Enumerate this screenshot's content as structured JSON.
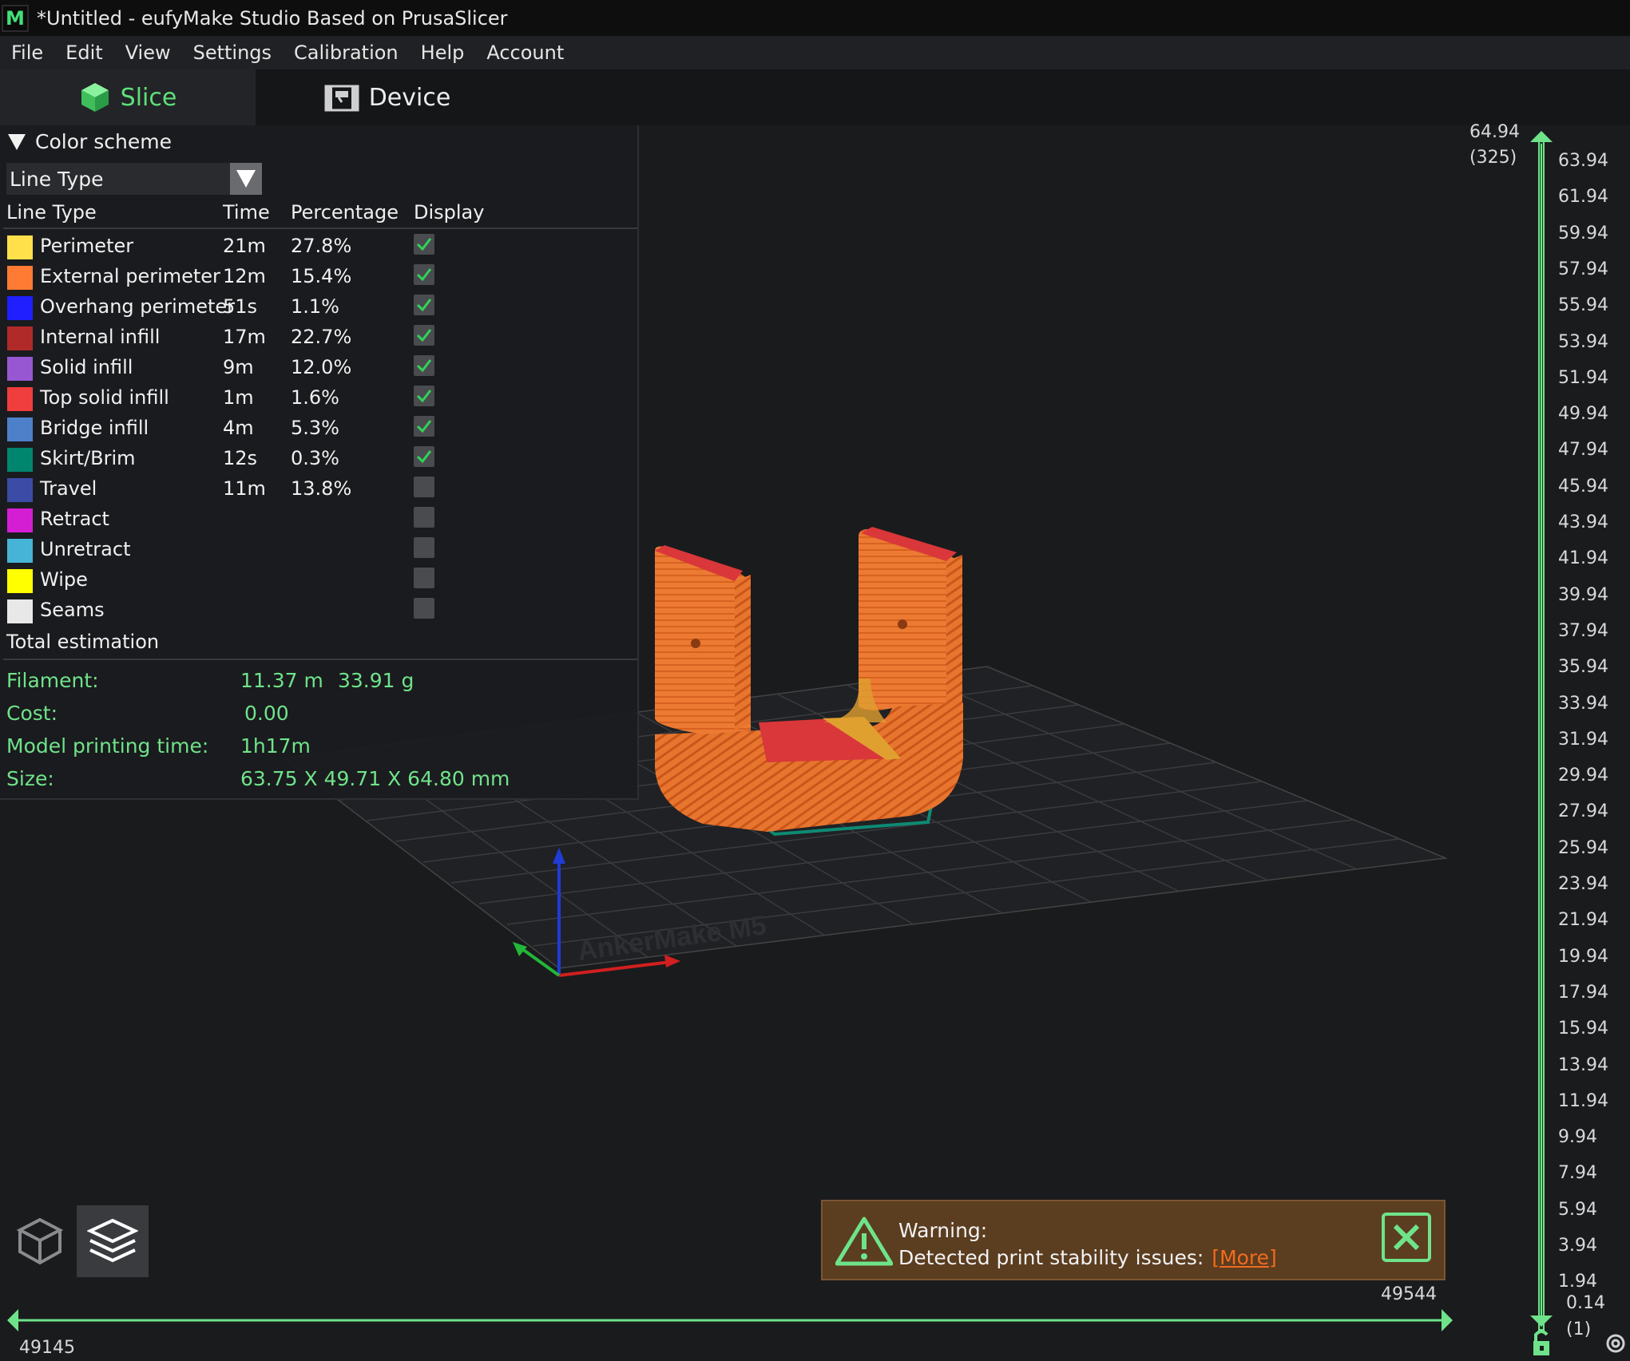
{
  "window": {
    "title": "*Untitled - eufyMake Studio Based on PrusaSlicer",
    "app_icon_letter": "M"
  },
  "menu": [
    "File",
    "Edit",
    "View",
    "Settings",
    "Calibration",
    "Help",
    "Account"
  ],
  "tabs": {
    "slice": "Slice",
    "device": "Device"
  },
  "legend": {
    "header": "Color scheme",
    "scheme_selected": "Line Type",
    "columns": {
      "type": "Line Type",
      "time": "Time",
      "percentage": "Percentage",
      "display": "Display"
    },
    "rows": [
      {
        "label": "Perimeter",
        "time": "21m",
        "pct": "27.8%",
        "color": "#FFE04A",
        "display": true
      },
      {
        "label": "External perimeter",
        "time": "12m",
        "pct": "15.4%",
        "color": "#FF7B33",
        "display": true
      },
      {
        "label": "Overhang perimeter",
        "time": "51s",
        "pct": "1.1%",
        "color": "#1F1FFF",
        "display": true
      },
      {
        "label": "Internal infill",
        "time": "17m",
        "pct": "22.7%",
        "color": "#B02A2A",
        "display": true
      },
      {
        "label": "Solid infill",
        "time": "9m",
        "pct": "12.0%",
        "color": "#9757D3",
        "display": true
      },
      {
        "label": "Top solid infill",
        "time": "1m",
        "pct": "1.6%",
        "color": "#F03D3D",
        "display": true
      },
      {
        "label": "Bridge infill",
        "time": "4m",
        "pct": "5.3%",
        "color": "#4D80C8",
        "display": true
      },
      {
        "label": "Skirt/Brim",
        "time": "12s",
        "pct": "0.3%",
        "color": "#00856E",
        "display": true
      },
      {
        "label": "Travel",
        "time": "11m",
        "pct": "13.8%",
        "color": "#3B4BA6",
        "display": false
      },
      {
        "label": "Retract",
        "time": "",
        "pct": "",
        "color": "#D41ED4",
        "display": false
      },
      {
        "label": "Unretract",
        "time": "",
        "pct": "",
        "color": "#45B4D6",
        "display": false
      },
      {
        "label": "Wipe",
        "time": "",
        "pct": "",
        "color": "#FFFF00",
        "display": false
      },
      {
        "label": "Seams",
        "time": "",
        "pct": "",
        "color": "#E8E8E8",
        "display": false
      }
    ],
    "total": {
      "label": "Total estimation",
      "filament_label": "Filament:",
      "filament_length": "11.37 m",
      "filament_weight": "33.91 g",
      "cost_label": "Cost:",
      "cost": "0.00",
      "time_label": "Model printing time:",
      "time": "1h17m",
      "size_label": "Size:",
      "size": "63.75 X 49.71 X 64.80 mm"
    }
  },
  "vertical_slider": {
    "top_value": "64.94",
    "top_layer": "(325)",
    "bottom_value": "0.14",
    "bottom_layer": "(1)",
    "ticks": [
      "63.94",
      "61.94",
      "59.94",
      "57.94",
      "55.94",
      "53.94",
      "51.94",
      "49.94",
      "47.94",
      "45.94",
      "43.94",
      "41.94",
      "39.94",
      "37.94",
      "35.94",
      "33.94",
      "31.94",
      "29.94",
      "27.94",
      "25.94",
      "23.94",
      "21.94",
      "19.94",
      "17.94",
      "15.94",
      "13.94",
      "11.94",
      "9.94",
      "7.94",
      "5.94",
      "3.94",
      "1.94"
    ]
  },
  "horizontal_slider": {
    "left_value": "49145",
    "right_value": "49544"
  },
  "bed_label": "AnkerMake M5",
  "warning": {
    "title": "Warning:",
    "message": "Detected print stability issues:",
    "link": "[More]"
  },
  "colors": {
    "accent": "#5EE07A",
    "warning_bg": "#5B3D20",
    "warning_link": "#F26B1D",
    "model_orange": "#E8752E",
    "model_red": "#D9373A"
  }
}
